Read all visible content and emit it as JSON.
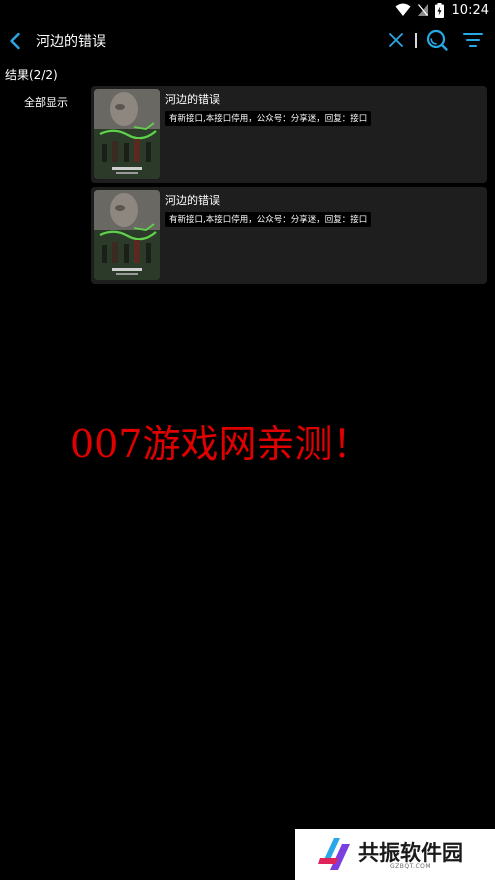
{
  "status_bar": {
    "time": "10:24",
    "icons": [
      "wifi-icon",
      "signal-off-icon",
      "battery-charging-icon"
    ]
  },
  "search_bar": {
    "query": "河边的错误",
    "icons": {
      "back": "back-chevron-icon",
      "clear": "close-icon",
      "search": "search-icon",
      "filter": "filter-icon"
    },
    "accent_color": "#29a8e6"
  },
  "results": {
    "count_label": "结果(2/2)",
    "category": "全部显示",
    "items": [
      {
        "title": "河边的错误",
        "remark": "有新接口,本接口停用，公众号：分享迷，回复：接口"
      },
      {
        "title": "河边的错误",
        "remark": "有新接口,本接口停用，公众号：分享迷，回复：接口"
      }
    ]
  },
  "watermark": {
    "text": "007游戏网亲测！",
    "color": "#e00000"
  },
  "logo": {
    "name": "共振软件园",
    "sub": "GZBQT.COM"
  }
}
